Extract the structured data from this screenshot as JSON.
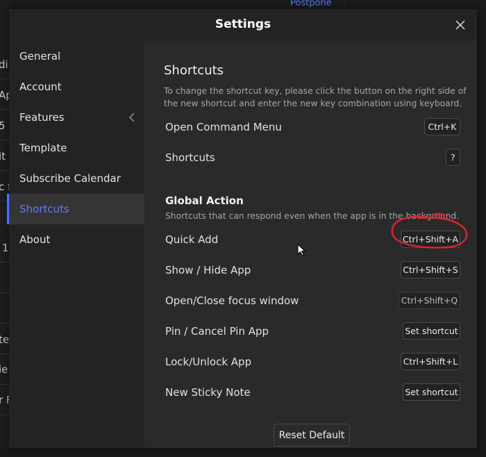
{
  "background": {
    "fragments": [
      "di",
      "Ap",
      "5 l",
      "it",
      "c f",
      "1",
      "te",
      "ie",
      "r F"
    ],
    "postpone": "Postpone"
  },
  "dialog": {
    "title": "Settings",
    "close_icon": "close-icon"
  },
  "sidebar": {
    "items": [
      {
        "label": "General"
      },
      {
        "label": "Account"
      },
      {
        "label": "Features",
        "icon": "chevron-left-icon"
      },
      {
        "label": "Template"
      },
      {
        "label": "Subscribe Calendar"
      },
      {
        "label": "Shortcuts",
        "active": true
      },
      {
        "label": "About"
      }
    ],
    "accent_color": "#4b74ff"
  },
  "content": {
    "title": "Shortcuts",
    "description": "To change the shortcut key, please click the button on the right side of the new shortcut and enter the new key combination using keyboard.",
    "shortcuts": [
      {
        "label": "Open Command Menu",
        "key": "Ctrl+K"
      },
      {
        "label": "Shortcuts",
        "key": "?"
      }
    ],
    "global": {
      "title": "Global Action",
      "description": "Shortcuts that can respond even when the app is in the background.",
      "items": [
        {
          "label": "Quick Add",
          "key": "Ctrl+Shift+A"
        },
        {
          "label": "Show / Hide App",
          "key": "Ctrl+Shift+S"
        },
        {
          "label": "Open/Close focus window",
          "key": "Ctrl+Shift+Q"
        },
        {
          "label": "Pin / Cancel Pin App",
          "key": "Set shortcut"
        },
        {
          "label": "Lock/Unlock App",
          "key": "Ctrl+Shift+L"
        },
        {
          "label": "New Sticky Note",
          "key": "Set shortcut"
        }
      ]
    },
    "reset_label": "Reset Default"
  },
  "annotation": {
    "color": "#e0242a"
  }
}
